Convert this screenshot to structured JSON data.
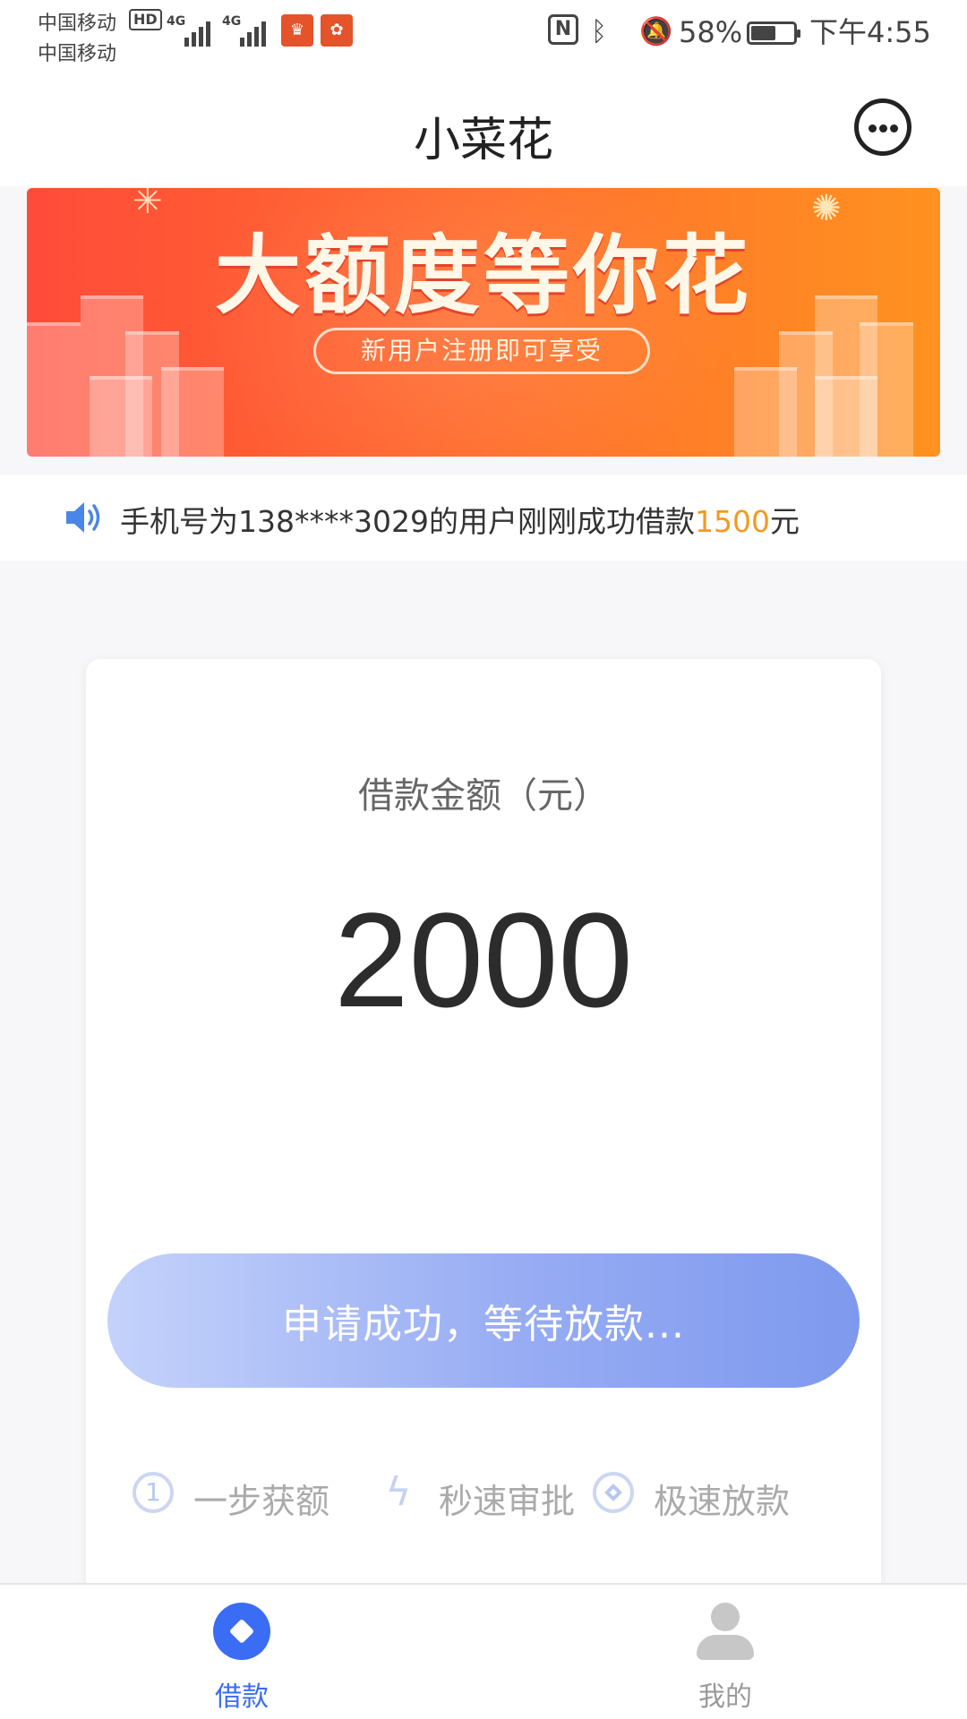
{
  "status_bar": {
    "carrier1": "中国移动",
    "carrier2": "中国移动",
    "hd": "HD",
    "network1": "4G",
    "network2": "4G",
    "nfc": "N",
    "battery_percent": "58%",
    "battery_level": 0.58,
    "time": "下午4:55"
  },
  "header": {
    "title": "小菜花",
    "chat_icon": "chat-bubble-icon"
  },
  "banner": {
    "title": "大额度等你花",
    "subtitle": "新用户注册即可享受"
  },
  "notice": {
    "icon": "speaker-icon",
    "prefix": "手机号为138****3029的用户刚刚成功借款",
    "amount": "1500",
    "suffix": "元"
  },
  "loan_card": {
    "amount_label": "借款金额（元）",
    "amount_value": "2000",
    "apply_button": "申请成功，等待放款...",
    "features": [
      {
        "icon": "circled-one-icon",
        "label": "一步获额"
      },
      {
        "icon": "lightning-icon",
        "label": "秒速审批"
      },
      {
        "icon": "diamond-coin-icon",
        "label": "极速放款"
      }
    ]
  },
  "bottom_nav": {
    "items": [
      {
        "label": "借款",
        "icon": "loan-diamond-icon",
        "active": true
      },
      {
        "label": "我的",
        "icon": "person-icon",
        "active": false
      }
    ]
  },
  "colors": {
    "accent": "#3a6cf4",
    "highlight": "#f29a1f",
    "button_start": "#c4d2fb",
    "button_end": "#7e99ee"
  }
}
